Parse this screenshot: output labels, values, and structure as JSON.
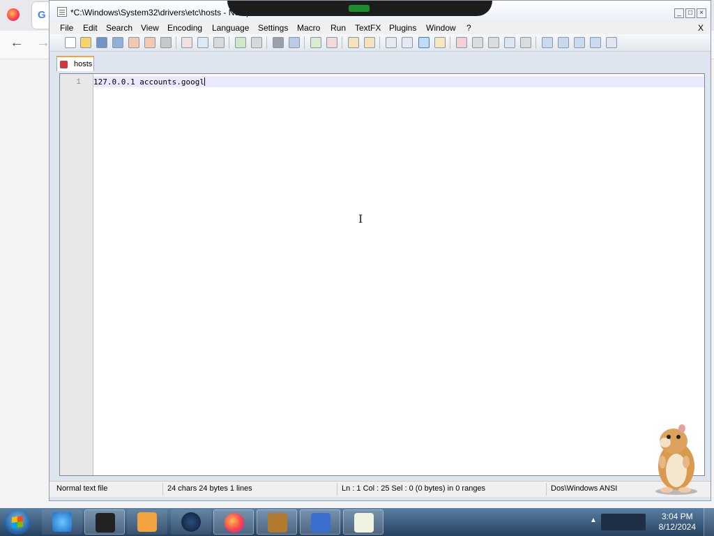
{
  "firefox": {
    "google_tab_favicon": "G"
  },
  "window": {
    "title": "*C:\\Windows\\System32\\drivers\\etc\\hosts - Notepad++",
    "close_menu_symbol": "X"
  },
  "menu": [
    "File",
    "Edit",
    "Search",
    "View",
    "Encoding",
    "Language",
    "Settings",
    "Macro",
    "Run",
    "TextFX",
    "Plugins",
    "Window",
    "?"
  ],
  "tab": {
    "label": "hosts"
  },
  "editor": {
    "line_number": "1",
    "line_text": "127.0.0.1 accounts.googl"
  },
  "status": {
    "file_type": "Normal text file",
    "length": "24 chars   24 bytes   1 lines",
    "position": "Ln : 1    Col : 25    Sel : 0 (0 bytes) in 0 ranges",
    "encoding": "Dos\\Windows  ANSI"
  },
  "taskbar": {
    "time": "3:04 PM",
    "date": "8/12/2024"
  }
}
